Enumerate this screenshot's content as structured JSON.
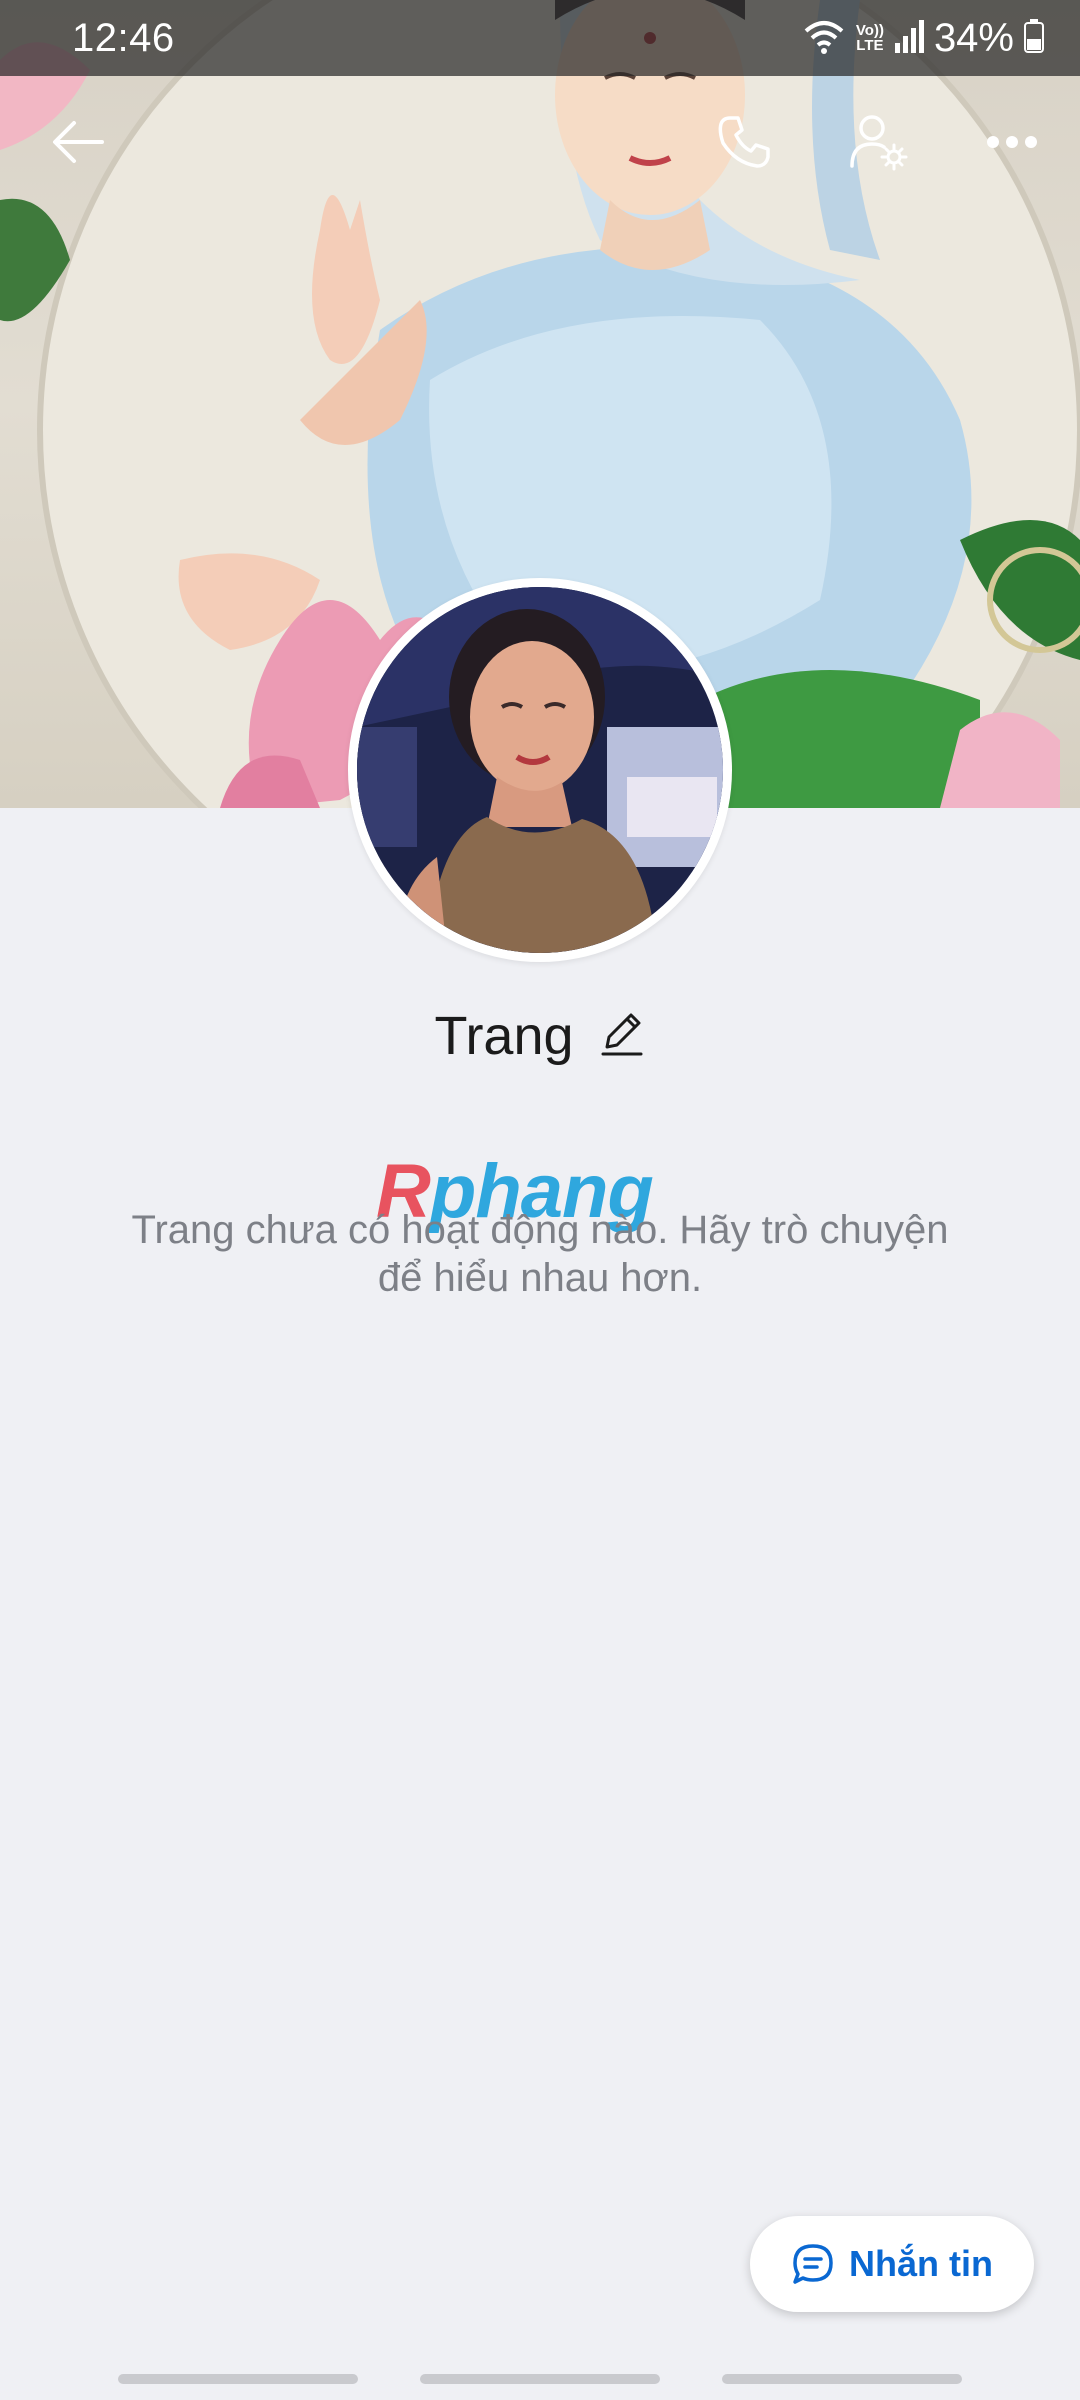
{
  "status_bar": {
    "time": "12:46",
    "battery": "34%",
    "volte_top": "Vo))",
    "volte_bottom": "LTE",
    "icons": [
      "wifi-icon",
      "volte-icon",
      "signal-icon",
      "battery-icon"
    ]
  },
  "app_bar": {
    "icons": [
      "back-arrow-icon",
      "phone-call-icon",
      "user-settings-icon",
      "more-options-icon"
    ]
  },
  "profile": {
    "name": "Trang",
    "edit_icon": "pencil-icon"
  },
  "feed": {
    "empty_line_1": "Trang chưa có hoạt động nào. Hãy trò chuyện",
    "empty_line_2": "để hiểu nhau hơn."
  },
  "watermark": {
    "part1": "R",
    "part2": "phang"
  },
  "actions": {
    "message_label": "Nhắn tin",
    "message_icon": "chat-bubble-icon"
  },
  "colors": {
    "background": "#eff0f4",
    "accent": "#0a68d2",
    "name_text": "#1b1b1b",
    "muted_text": "#7d8087"
  }
}
